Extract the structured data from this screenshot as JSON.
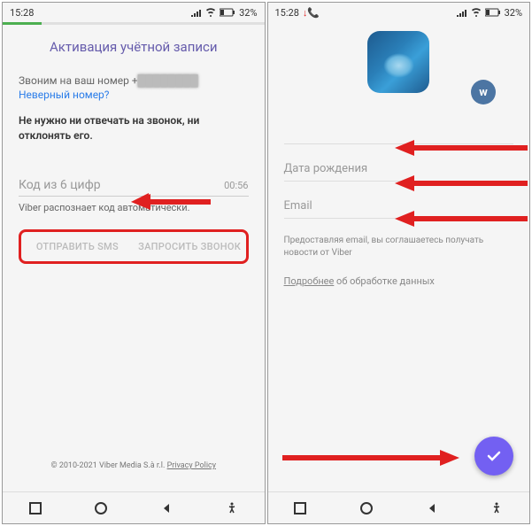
{
  "left": {
    "status": {
      "time": "15:28",
      "battery": "32%"
    },
    "title": "Активация учётной записи",
    "call_prefix": "Звоним на ваш номер +",
    "wrong_number": "Неверный номер?",
    "instruction": "Не нужно ни отвечать на звонок, ни отклонять его.",
    "code_placeholder": "Код из 6 цифр",
    "timer": "00:56",
    "auto_detect": "Viber распознает код автоматически.",
    "btn_sms": "ОТПРАВИТЬ SMS",
    "btn_call": "ЗАПРОСИТЬ ЗВОНОК",
    "copyright": "© 2010-2021 Viber Media S.à r.l.",
    "privacy": "Privacy Policy"
  },
  "right": {
    "status": {
      "time": "15:28",
      "battery": "32%"
    },
    "field_name": "",
    "field_birthday": "Дата рождения",
    "field_email": "Email",
    "consent": "Предоставляя email, вы соглашаетесь получать новости от Viber",
    "more_label": "Подробнее",
    "more_rest": " об обработке данных",
    "vk_label": "w"
  }
}
